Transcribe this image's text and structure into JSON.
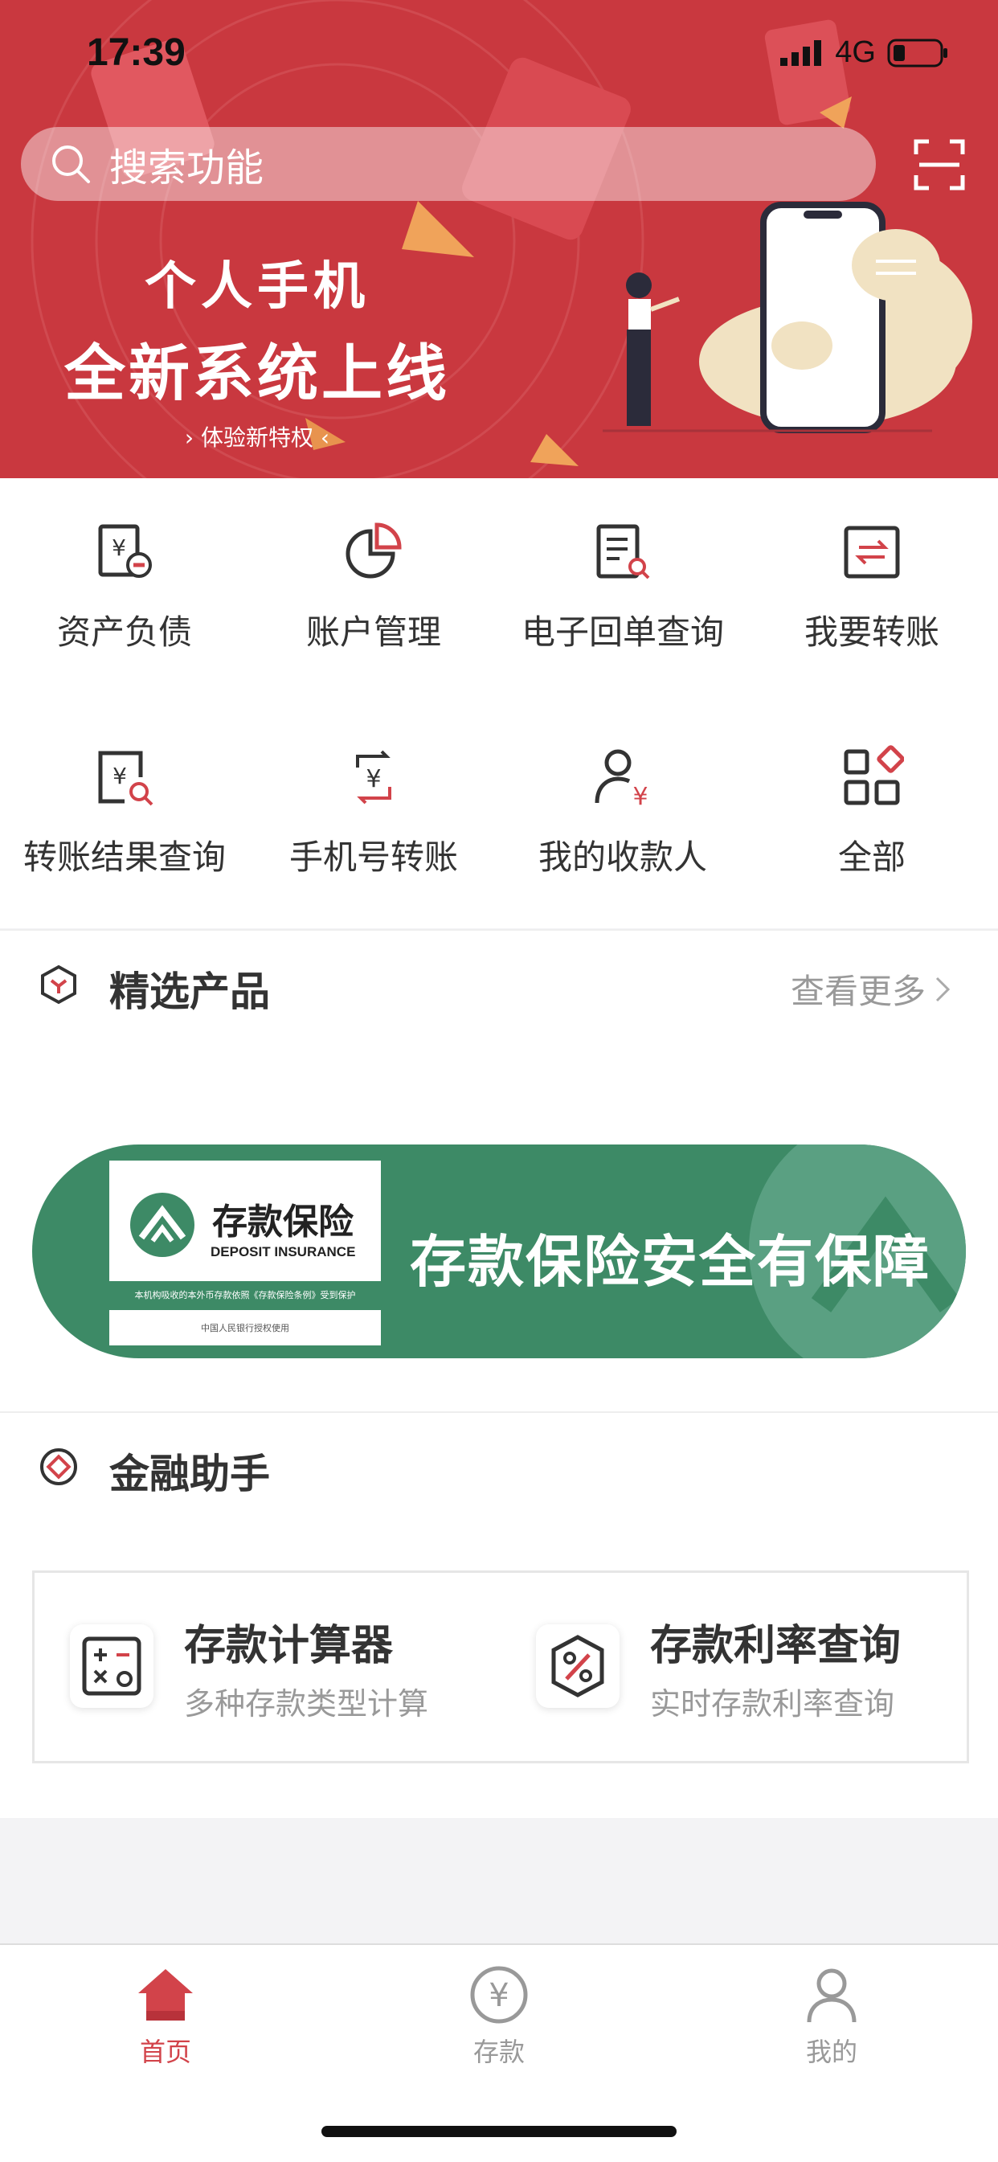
{
  "status_bar": {
    "time": "17:39",
    "network": "4G"
  },
  "search": {
    "placeholder": "搜索功能"
  },
  "hero": {
    "line1": "个人手机",
    "line2": "全新系统上线",
    "line3": "› 体验新特权 ‹"
  },
  "menu": {
    "items": [
      {
        "label": "资产负债",
        "icon": "asset-liability-icon"
      },
      {
        "label": "账户管理",
        "icon": "pie-chart-icon"
      },
      {
        "label": "电子回单查询",
        "icon": "receipt-search-icon"
      },
      {
        "label": "我要转账",
        "icon": "transfer-icon"
      },
      {
        "label": "转账结果查询",
        "icon": "transfer-result-icon"
      },
      {
        "label": "手机号转账",
        "icon": "phone-transfer-icon"
      },
      {
        "label": "我的收款人",
        "icon": "payee-icon"
      },
      {
        "label": "全部",
        "icon": "all-apps-icon"
      }
    ]
  },
  "featured": {
    "title": "精选产品",
    "more": "查看更多"
  },
  "promo": {
    "brand": "存款保险",
    "brand_en": "DEPOSIT INSURANCE",
    "strip": "本机构吸收的本外币存款依照《存款保险条例》受到保护",
    "small": "中国人民银行授权使用",
    "slogan": "存款保险安全有保障"
  },
  "assistant": {
    "title": "金融助手",
    "tools": [
      {
        "title": "存款计算器",
        "subtitle": "多种存款类型计算",
        "icon": "calculator-icon"
      },
      {
        "title": "存款利率查询",
        "subtitle": "实时存款利率查询",
        "icon": "percent-icon"
      }
    ]
  },
  "tabbar": {
    "tabs": [
      {
        "label": "首页",
        "icon": "home-icon",
        "active": true
      },
      {
        "label": "存款",
        "icon": "yuan-circle-icon",
        "active": false
      },
      {
        "label": "我的",
        "icon": "user-icon",
        "active": false
      }
    ]
  },
  "colors": {
    "brand_red": "#c9383f",
    "accent_red": "#d2434a",
    "promo_green": "#3d8a66"
  }
}
